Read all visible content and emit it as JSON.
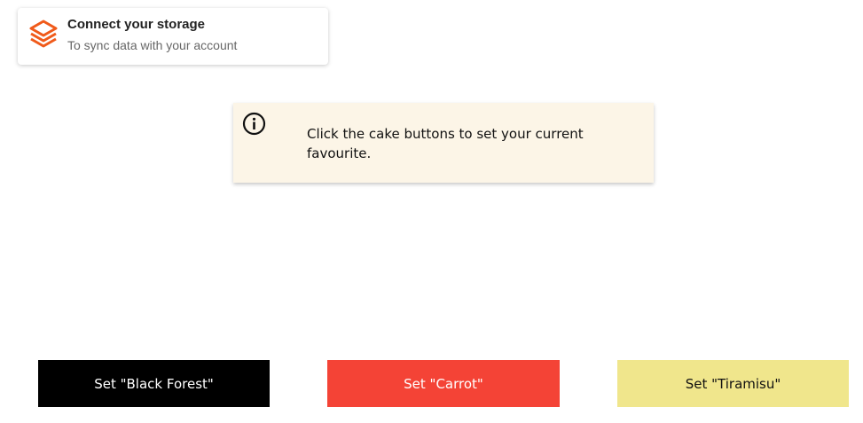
{
  "storage_card": {
    "title": "Connect your storage",
    "subtitle": "To sync data with your account",
    "icon": "stacked-layers-icon",
    "accent_color": "#f05a1a"
  },
  "notice": {
    "icon": "info-circle-icon",
    "text": "Click the cake buttons to set your current favourite.",
    "background": "#fcf5e7"
  },
  "buttons": [
    {
      "label": "Set \"Black Forest\"",
      "background": "#000000",
      "color": "#ffffff"
    },
    {
      "label": "Set \"Carrot\"",
      "background": "#f44336",
      "color": "#ffffff"
    },
    {
      "label": "Set \"Tiramisu\"",
      "background": "#f0e68c",
      "color": "#111111"
    }
  ]
}
